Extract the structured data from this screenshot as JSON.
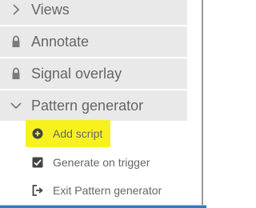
{
  "sections": [
    {
      "label": "Views",
      "icon": "chevron-right-icon"
    },
    {
      "label": "Annotate",
      "icon": "lock-icon"
    },
    {
      "label": "Signal overlay",
      "icon": "lock-icon"
    },
    {
      "label": "Pattern generator",
      "icon": "chevron-down-icon"
    }
  ],
  "pattern_generator": {
    "items": [
      {
        "label": "Add script",
        "icon": "plus-circle-icon",
        "highlighted": true
      },
      {
        "label": "Generate on trigger",
        "icon": "checkbox-checked-icon",
        "checked": true
      },
      {
        "label": "Exit Pattern generator",
        "icon": "exit-icon"
      }
    ]
  },
  "colors": {
    "section_bg": "#e9e9e9",
    "text": "#666666",
    "highlight": "#f7f21f",
    "accent_bottom": "#2f7dc3"
  }
}
